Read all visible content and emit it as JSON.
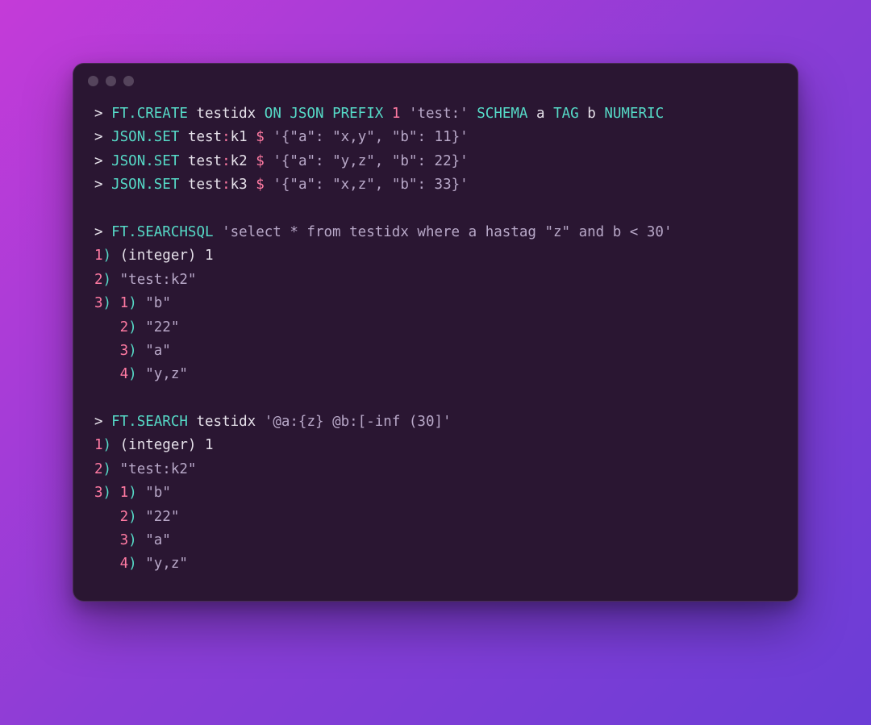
{
  "lines": {
    "l1": {
      "prompt": ">",
      "cmd": "FT.CREATE",
      "ident1": "testidx",
      "kw1": "ON JSON PREFIX",
      "num1": "1",
      "str1": "'test:'",
      "kw2": "SCHEMA",
      "a": "a",
      "kw3": "TAG",
      "b": "b",
      "kw4": "NUMERIC"
    },
    "l2": {
      "prompt": ">",
      "cmd": "JSON.SET",
      "ident": "test",
      "colon": ":",
      "key": "k1",
      "dollar": "$",
      "str": "'{\"a\": \"x,y\", \"b\": 11}'"
    },
    "l3": {
      "prompt": ">",
      "cmd": "JSON.SET",
      "ident": "test",
      "colon": ":",
      "key": "k2",
      "dollar": "$",
      "str": "'{\"a\": \"y,z\", \"b\": 22}'"
    },
    "l4": {
      "prompt": ">",
      "cmd": "JSON.SET",
      "ident": "test",
      "colon": ":",
      "key": "k3",
      "dollar": "$",
      "str": "'{\"a\": \"x,z\", \"b\": 33}'"
    },
    "l5": {
      "prompt": ">",
      "cmd": "FT.SEARCHSQL",
      "str": "'select * from testidx where a hastag \"z\" and b < 30'"
    },
    "r1": {
      "n": "1",
      "p": ")",
      "txt": " (integer) 1"
    },
    "r2": {
      "n": "2",
      "p": ")",
      "txt": " \"test:k2\""
    },
    "r3": {
      "n": "3",
      "p": ")",
      "n2": "1",
      "p2": ")",
      "txt": " \"b\""
    },
    "r4": {
      "pad": "   ",
      "n": "2",
      "p": ")",
      "txt": " \"22\""
    },
    "r5": {
      "pad": "   ",
      "n": "3",
      "p": ")",
      "txt": " \"a\""
    },
    "r6": {
      "pad": "   ",
      "n": "4",
      "p": ")",
      "txt": " \"y,z\""
    },
    "l6": {
      "prompt": ">",
      "cmd": "FT.SEARCH",
      "ident": "testidx",
      "str": "'@a:{z} @b:[-inf (30]'"
    },
    "s1": {
      "n": "1",
      "p": ")",
      "txt": " (integer) 1"
    },
    "s2": {
      "n": "2",
      "p": ")",
      "txt": " \"test:k2\""
    },
    "s3": {
      "n": "3",
      "p": ")",
      "n2": "1",
      "p2": ")",
      "txt": " \"b\""
    },
    "s4": {
      "pad": "   ",
      "n": "2",
      "p": ")",
      "txt": " \"22\""
    },
    "s5": {
      "pad": "   ",
      "n": "3",
      "p": ")",
      "txt": " \"a\""
    },
    "s6": {
      "pad": "   ",
      "n": "4",
      "p": ")",
      "txt": " \"y,z\""
    }
  }
}
